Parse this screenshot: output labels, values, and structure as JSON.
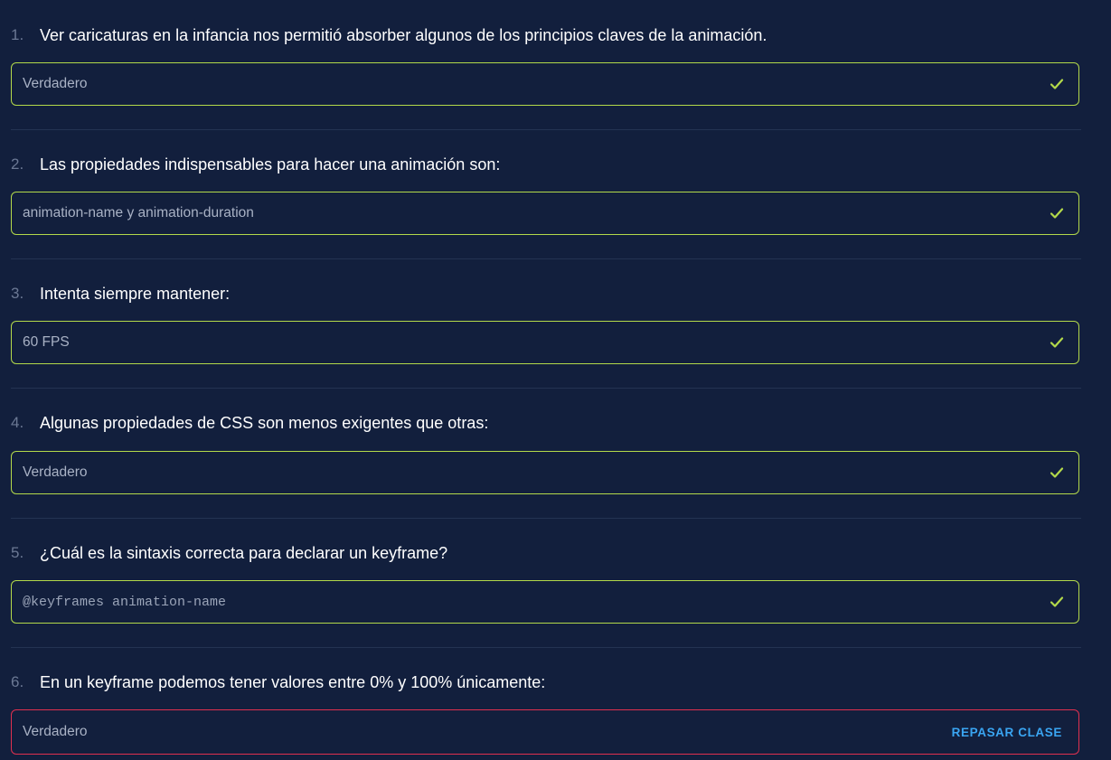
{
  "questions": [
    {
      "number": "1.",
      "text": "Ver caricaturas en la infancia nos permitió absorber algunos de los principios claves de la animación.",
      "answer": "Verdadero",
      "status": "correct"
    },
    {
      "number": "2.",
      "text": "Las propiedades indispensables para hacer una animación son:",
      "answer": "animation-name y animation-duration",
      "status": "correct"
    },
    {
      "number": "3.",
      "text": "Intenta siempre mantener:",
      "answer": "60 FPS",
      "status": "correct"
    },
    {
      "number": "4.",
      "text": "Algunas propiedades de CSS son menos exigentes que otras:",
      "answer": "Verdadero",
      "status": "correct"
    },
    {
      "number": "5.",
      "text": "¿Cuál es la sintaxis correcta para declarar un keyframe?",
      "answer": "@keyframes animation-name",
      "status": "correct"
    },
    {
      "number": "6.",
      "text": "En un keyframe podemos tener valores entre 0% y 100% únicamente:",
      "answer": "Verdadero",
      "status": "incorrect",
      "action_label": "REPASAR CLASE"
    }
  ],
  "colors": {
    "background": "#121f3d",
    "correct_border": "#b3d94a",
    "incorrect_border": "#e0304f",
    "link": "#3aa5f2"
  }
}
